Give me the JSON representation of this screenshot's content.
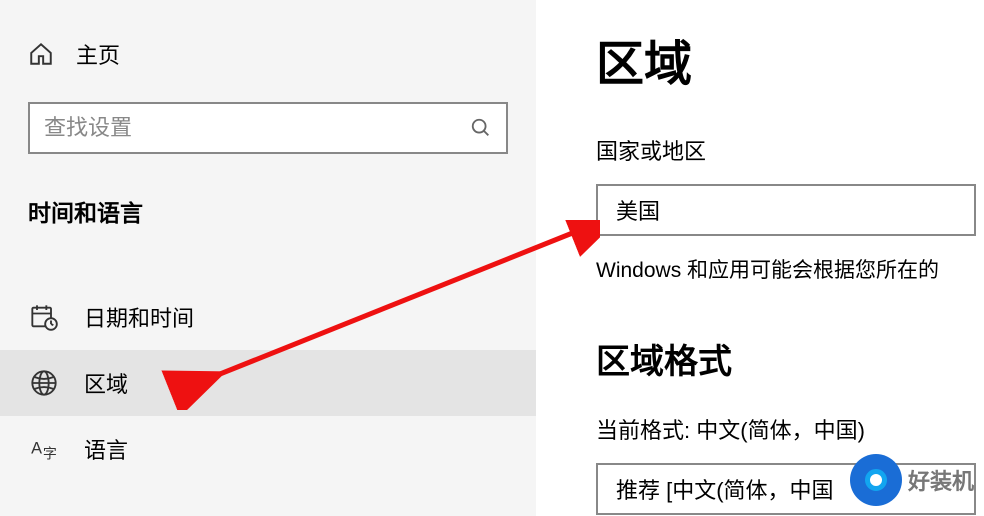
{
  "sidebar": {
    "home": "主页",
    "search_placeholder": "查找设置",
    "section": "时间和语言",
    "items": [
      {
        "label": "日期和时间"
      },
      {
        "label": "区域"
      },
      {
        "label": "语言"
      }
    ]
  },
  "main": {
    "title": "区域",
    "country_label": "国家或地区",
    "country_value": "美国",
    "hint": "Windows 和应用可能会根据您所在的",
    "format_title": "区域格式",
    "current_format_label": "当前格式:",
    "current_format_value": "中文(简体，中国)",
    "format_dropdown_value": "推荐 [中文(简体，中国"
  },
  "watermark": "好装机"
}
